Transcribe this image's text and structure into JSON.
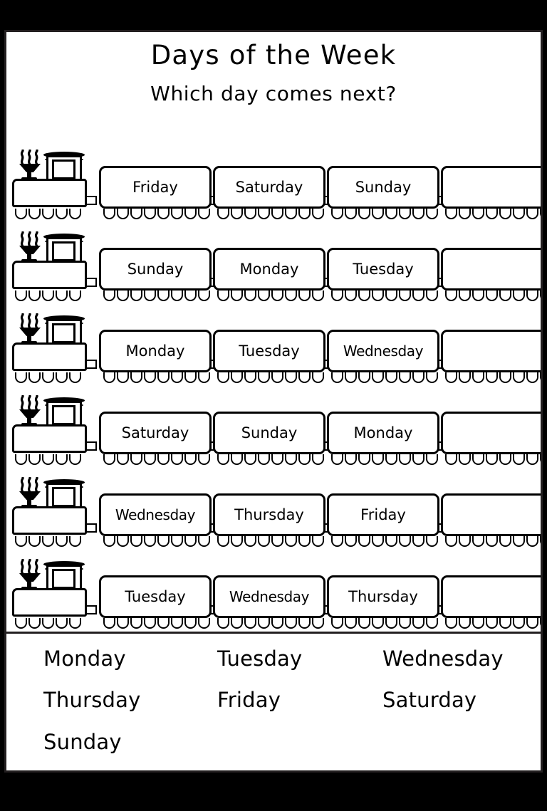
{
  "page": {
    "title": "Days of the Week",
    "subtitle": "Which day comes next?",
    "background_color": "#000000",
    "sheet_color": "#ffffff",
    "border_color": "#231f20",
    "ink_color": "#000000"
  },
  "train_rows": [
    {
      "row_index": 1,
      "locomotive": "steam-locomotive",
      "carriages": [
        {
          "label": "Friday",
          "blank": false
        },
        {
          "label": "Saturday",
          "blank": false
        },
        {
          "label": "Sunday",
          "blank": false
        },
        {
          "label": "",
          "blank": true
        }
      ]
    },
    {
      "row_index": 2,
      "locomotive": "steam-locomotive",
      "carriages": [
        {
          "label": "Sunday",
          "blank": false
        },
        {
          "label": "Monday",
          "blank": false
        },
        {
          "label": "Tuesday",
          "blank": false
        },
        {
          "label": "",
          "blank": true
        }
      ]
    },
    {
      "row_index": 3,
      "locomotive": "steam-locomotive",
      "carriages": [
        {
          "label": "Monday",
          "blank": false
        },
        {
          "label": "Tuesday",
          "blank": false
        },
        {
          "label": "Wednesday",
          "blank": false
        },
        {
          "label": "",
          "blank": true
        }
      ]
    },
    {
      "row_index": 4,
      "locomotive": "steam-locomotive",
      "carriages": [
        {
          "label": "Saturday",
          "blank": false
        },
        {
          "label": "Sunday",
          "blank": false
        },
        {
          "label": "Monday",
          "blank": false
        },
        {
          "label": "",
          "blank": true
        }
      ]
    },
    {
      "row_index": 5,
      "locomotive": "steam-locomotive",
      "carriages": [
        {
          "label": "Wednesday",
          "blank": false
        },
        {
          "label": "Thursday",
          "blank": false
        },
        {
          "label": "Friday",
          "blank": false
        },
        {
          "label": "",
          "blank": true
        }
      ]
    },
    {
      "row_index": 6,
      "locomotive": "steam-locomotive",
      "carriages": [
        {
          "label": "Tuesday",
          "blank": false
        },
        {
          "label": "Wednesday",
          "blank": false
        },
        {
          "label": "Thursday",
          "blank": false
        },
        {
          "label": "",
          "blank": true
        }
      ]
    }
  ],
  "word_bank": {
    "items": [
      "Monday",
      "Tuesday",
      "Wednesday",
      "Thursday",
      "Friday",
      "Saturday",
      "Sunday"
    ]
  }
}
